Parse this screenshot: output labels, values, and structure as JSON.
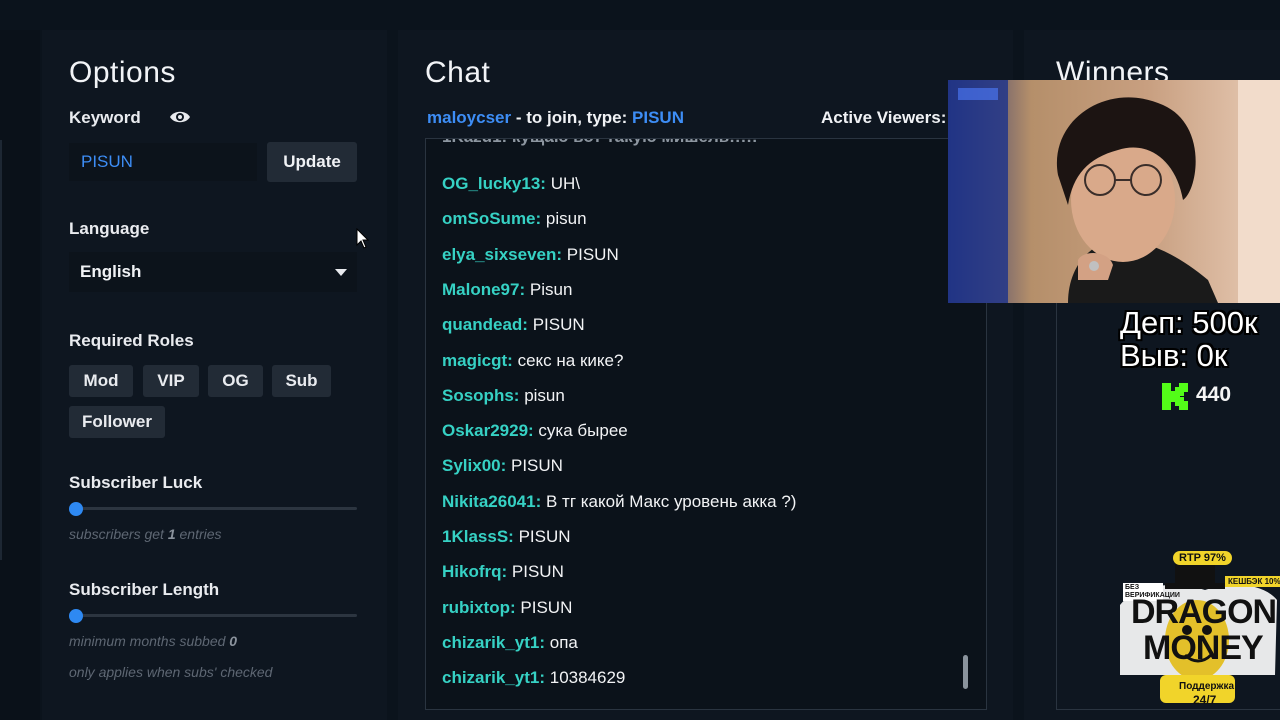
{
  "options": {
    "title": "Options",
    "keyword_label": "Keyword",
    "keyword_value": "PISUN",
    "update_label": "Update",
    "language_label": "Language",
    "language_value": "English",
    "roles_label": "Required Roles",
    "roles": [
      "Mod",
      "VIP",
      "OG",
      "Sub",
      "Follower"
    ],
    "subscriber_luck_label": "Subscriber Luck",
    "subscriber_luck_hint_prefix": "subscribers get",
    "subscriber_luck_value": "1",
    "subscriber_luck_hint_suffix": "entries",
    "subscriber_length_label": "Subscriber Length",
    "subscriber_length_hint_prefix": "minimum months subbed",
    "subscriber_length_value": "0",
    "subscriber_length_note": "only applies when subs' checked"
  },
  "chat": {
    "title": "Chat",
    "channel": "maloycser",
    "join_text": "- to join, type:",
    "join_keyword": "PISUN",
    "active_viewers_label": "Active Viewers:",
    "messages": [
      {
        "user": "OG_lucky13:",
        "text": "UH\\"
      },
      {
        "user": "omSoSume:",
        "text": "pisun"
      },
      {
        "user": "elya_sixseven:",
        "text": "PISUN"
      },
      {
        "user": "Malone97:",
        "text": "Pisun"
      },
      {
        "user": "quandead:",
        "text": "PISUN"
      },
      {
        "user": "magicgt:",
        "text": "секс на кике?"
      },
      {
        "user": "Sosophs:",
        "text": "pisun"
      },
      {
        "user": "Oskar2929:",
        "text": "сука бырее"
      },
      {
        "user": "Sylix00:",
        "text": "PISUN"
      },
      {
        "user": "Nikita26041:",
        "text": "В тг какой Макс уровень акка ?)"
      },
      {
        "user": "1KlassS:",
        "text": "PISUN"
      },
      {
        "user": "Hikofrq:",
        "text": "PISUN"
      },
      {
        "user": "rubixtop:",
        "text": "PISUN"
      },
      {
        "user": "chizarik_yt1:",
        "text": "опа"
      },
      {
        "user": "chizarik_yt1:",
        "text": "10384629"
      }
    ]
  },
  "winners": {
    "title": "Winners"
  },
  "stream_overlay": {
    "deposit": "Деп: 500к",
    "withdraw": "Выв: 0к",
    "kick_count": "440"
  },
  "promo": {
    "rtp": "RTP 97%",
    "cashback": "КЕШБЭК 10%",
    "no_verification": "БЕЗ ВЕРИФИКАЦИИ",
    "brand_line1": "DRAGON",
    "brand_line2": "MONEY",
    "support_line1": "Поддержка",
    "support_line2": "24/7"
  },
  "colors": {
    "accent": "#3d8df5",
    "username": "#36d1c4",
    "kick_green": "#53fc18"
  }
}
